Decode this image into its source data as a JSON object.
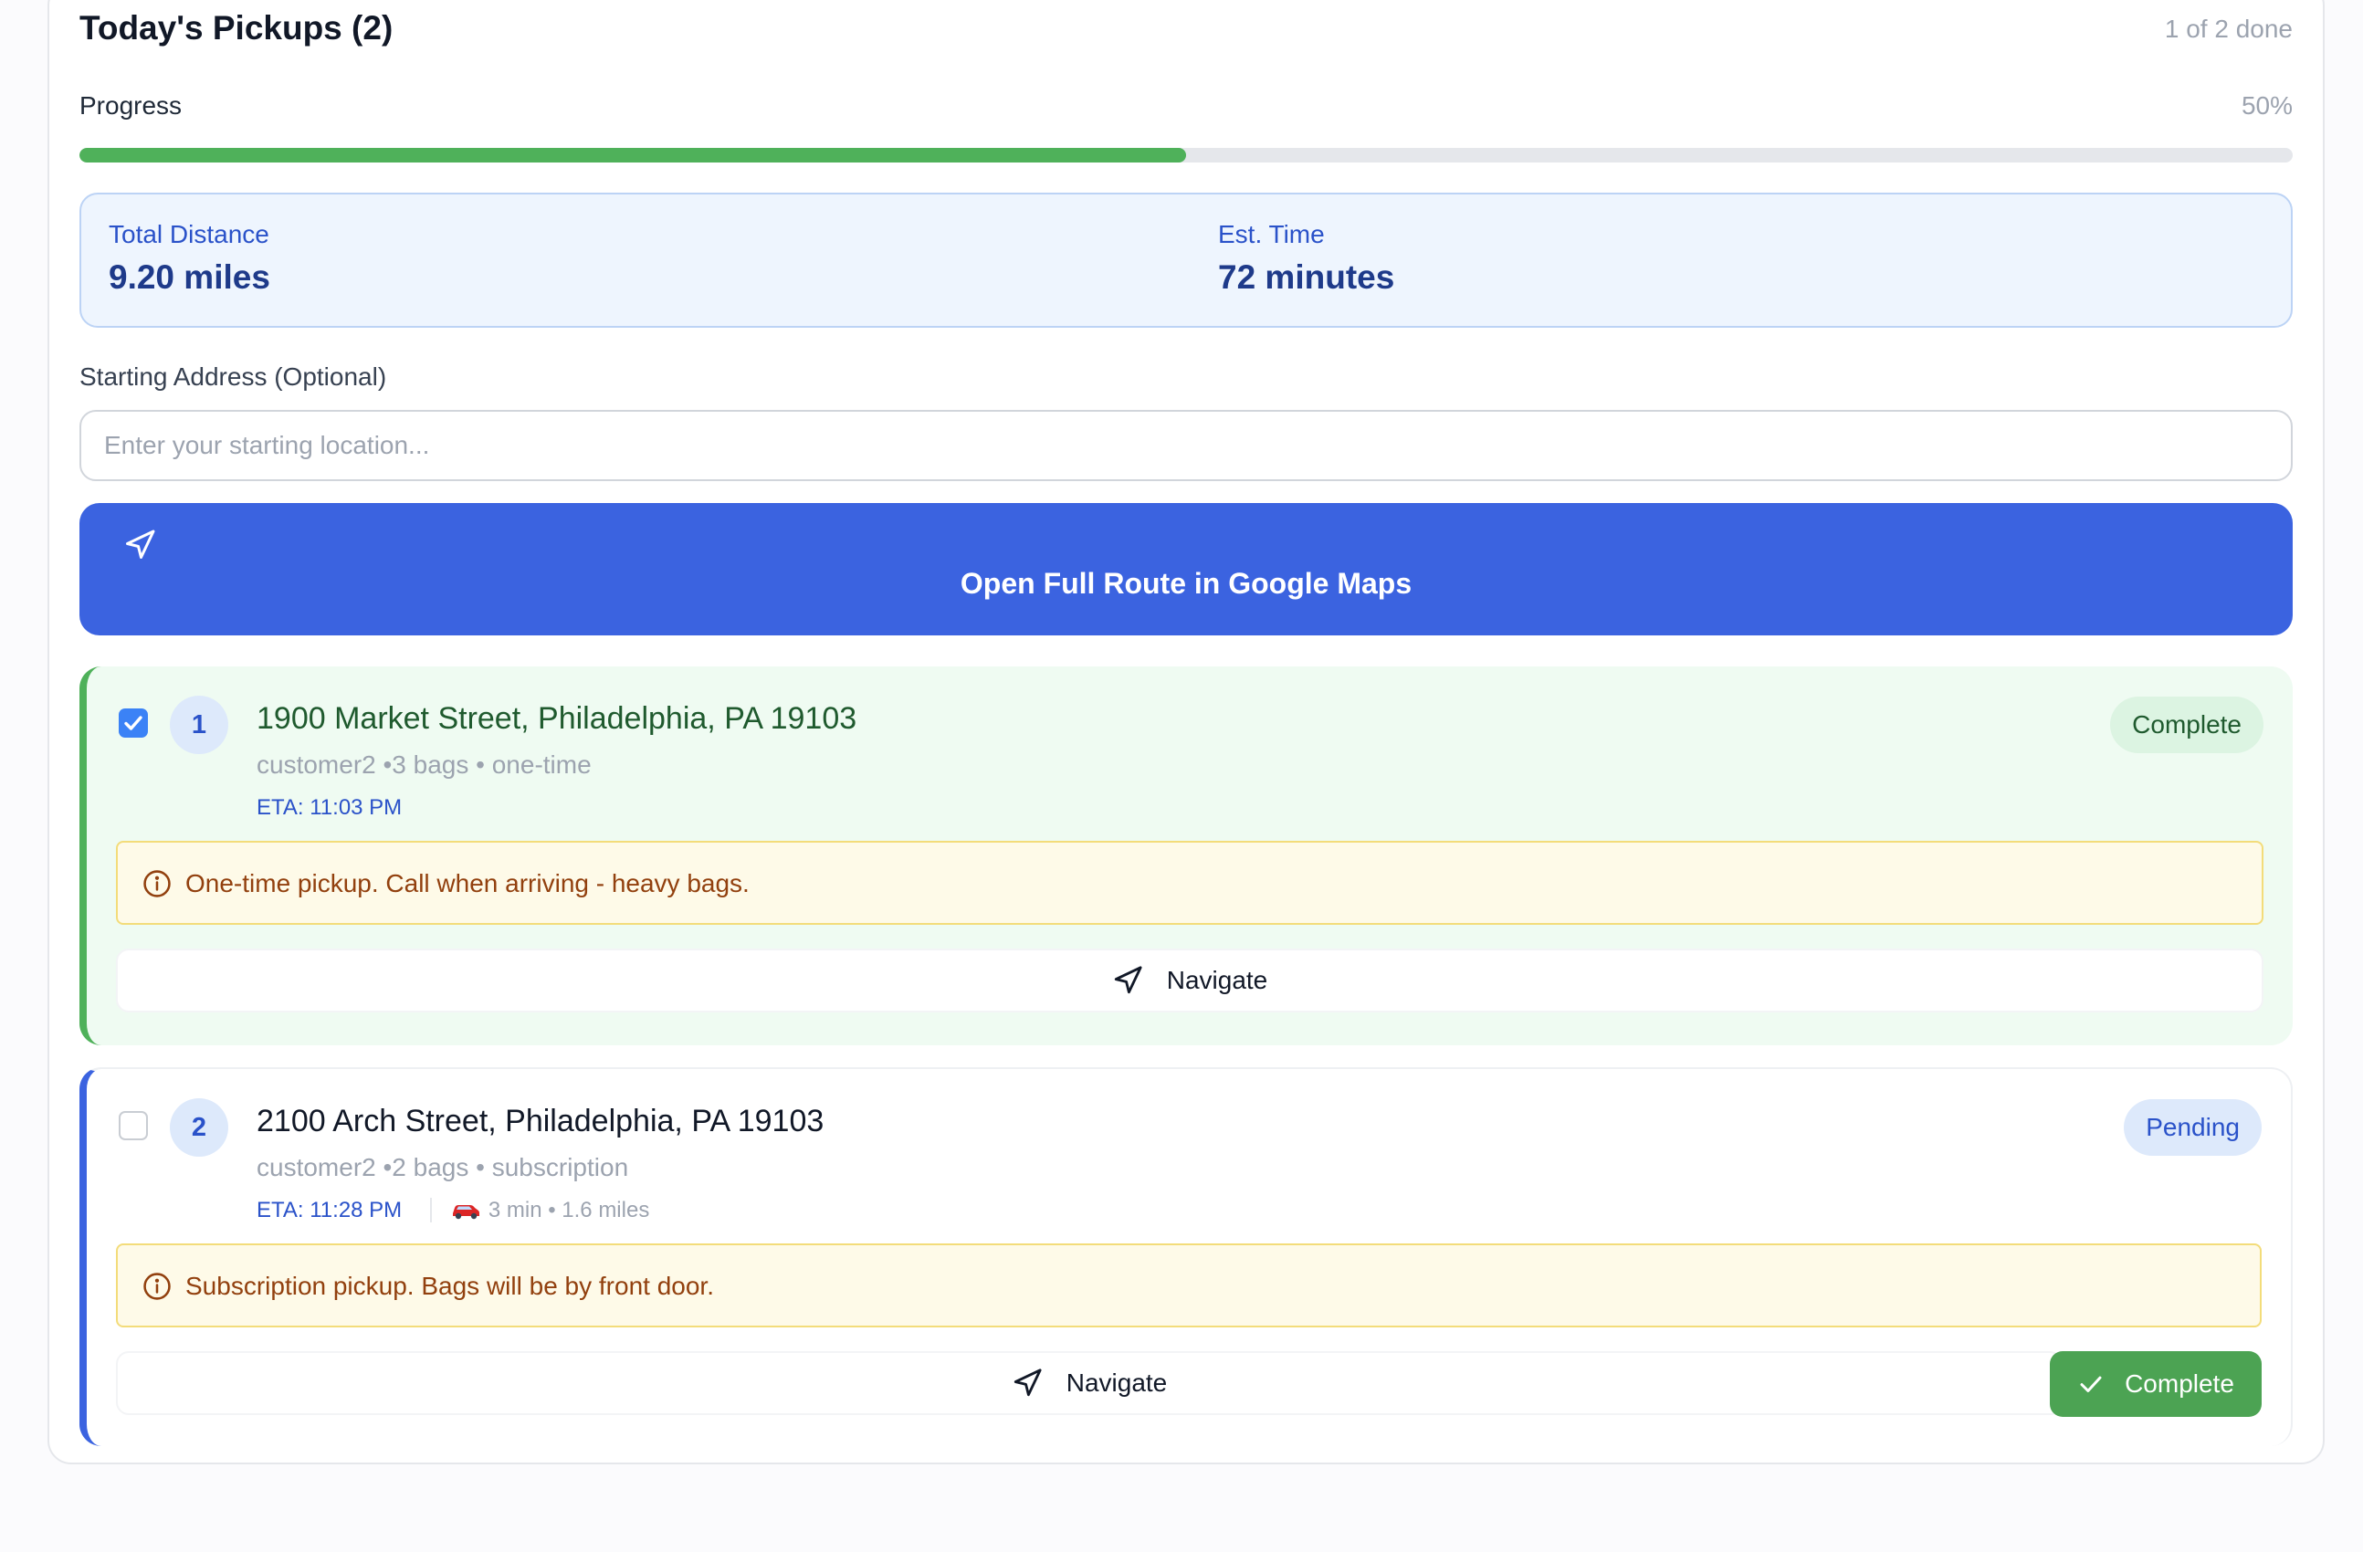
{
  "header": {
    "title": "Today's Pickups (2)",
    "done_text": "1 of 2 done"
  },
  "progress": {
    "label": "Progress",
    "percent_text": "50%",
    "fraction": 0.5,
    "color": "#4fb15a"
  },
  "summary": {
    "distance_label": "Total Distance",
    "distance_value": "9.20 miles",
    "time_label": "Est. Time",
    "time_value": "72 minutes"
  },
  "start": {
    "label": "Starting Address (Optional)",
    "placeholder": "Enter your starting location...",
    "value": ""
  },
  "maps_button": {
    "label": "Open Full Route in Google Maps",
    "icon": "navigation-arrow-icon",
    "color": "#3b63e0"
  },
  "stops": [
    {
      "number": "1",
      "checked": true,
      "address": "1900 Market Street, Philadelphia, PA 19103",
      "meta": "customer2 •3 bags • one-time",
      "eta": "ETA: 11:03 PM",
      "status": "Complete",
      "note": "One-time pickup. Call when arriving - heavy bags.",
      "navigate_label": "Navigate"
    },
    {
      "number": "2",
      "checked": false,
      "address": "2100 Arch Street, Philadelphia, PA 19103",
      "meta": "customer2 •2 bags • subscription",
      "eta": "ETA: 11:28 PM",
      "drive": "3 min • 1.6 miles",
      "status": "Pending",
      "note": "Subscription pickup. Bags will be by front door.",
      "navigate_label": "Navigate",
      "complete_label": "Complete"
    }
  ]
}
